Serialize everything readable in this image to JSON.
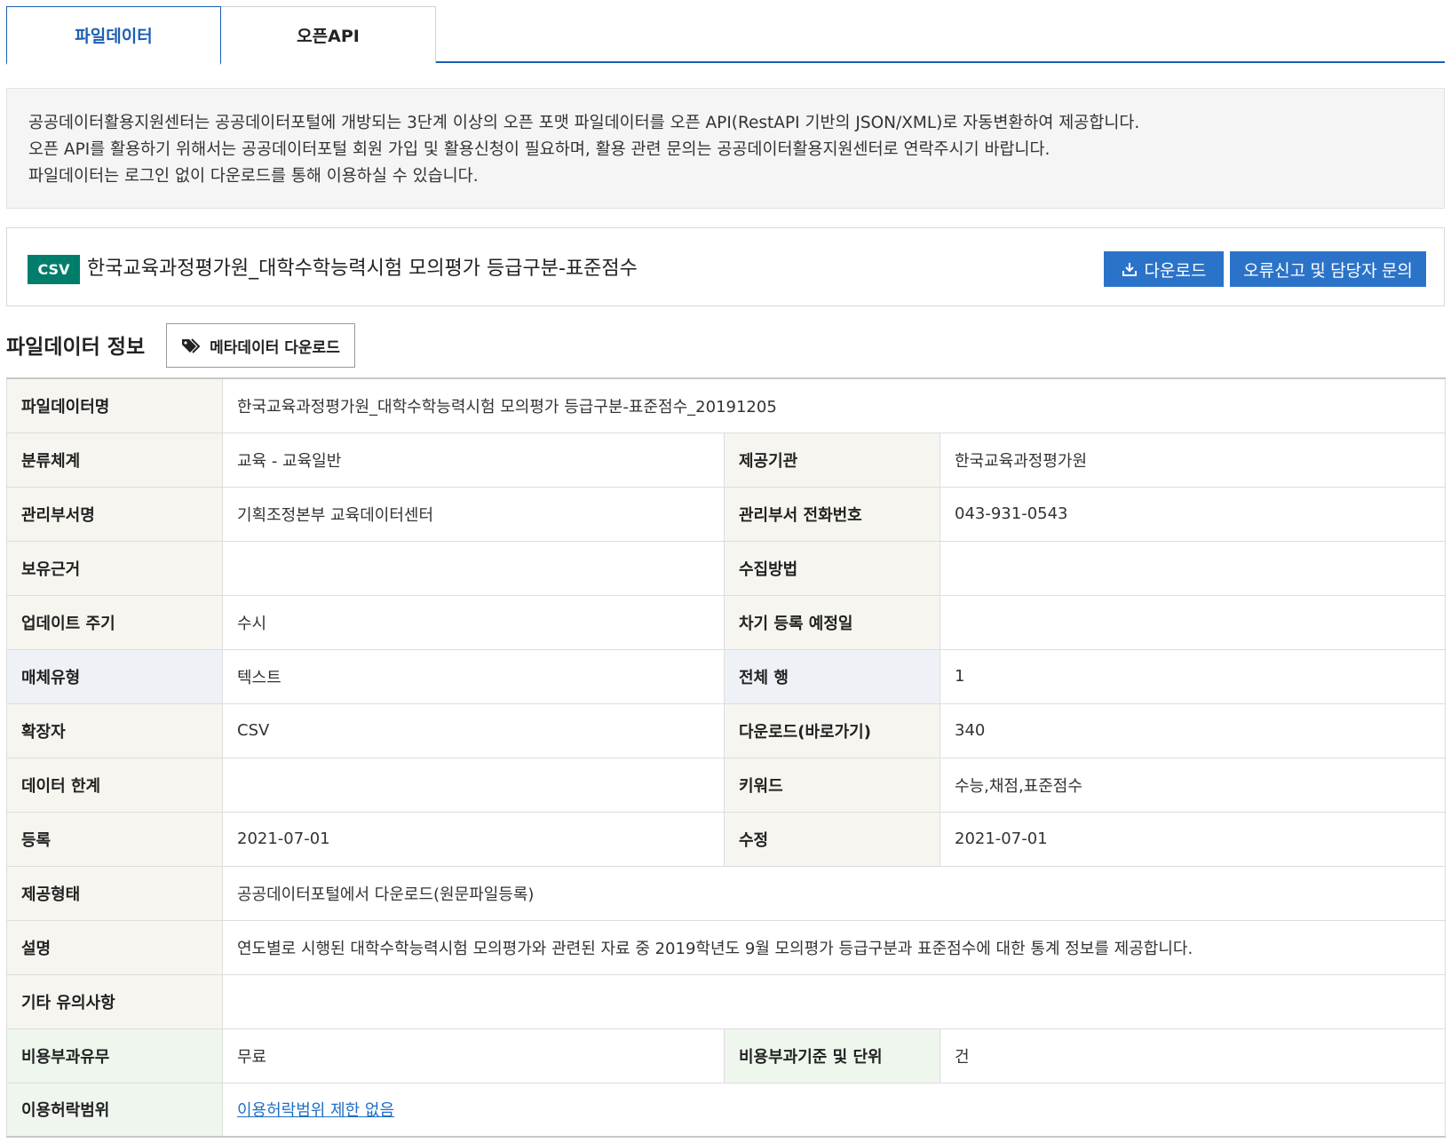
{
  "tabs": [
    {
      "label": "파일데이터",
      "active": true
    },
    {
      "label": "오픈API",
      "active": false
    }
  ],
  "notice": {
    "line1": "공공데이터활용지원센터는 공공데이터포털에 개방되는 3단계 이상의 오픈 포맷 파일데이터를 오픈 API(RestAPI 기반의 JSON/XML)로 자동변환하여 제공합니다.",
    "line2": "오픈 API를 활용하기 위해서는 공공데이터포털 회원 가입 및 활용신청이 필요하며, 활용 관련 문의는 공공데이터활용지원센터로 연락주시기 바랍니다.",
    "line3": "파일데이터는 로그인 없이 다운로드를 통해 이용하실 수 있습니다."
  },
  "dataset": {
    "format_badge": "CSV",
    "title": "한국교육과정평가원_대학수학능력시험 모의평가 등급구분-표준점수",
    "download_label": "다운로드",
    "report_label": "오류신고 및 담당자 문의"
  },
  "section": {
    "title": "파일데이터 정보",
    "meta_download_label": "메타데이터 다운로드"
  },
  "colors": {
    "accent": "#1b5fb4",
    "button_blue": "#2b73c9",
    "badge_green": "#007e6b",
    "link": "#1f6fc5"
  },
  "info": {
    "file_name": {
      "label": "파일데이터명",
      "value": "한국교육과정평가원_대학수학능력시험 모의평가 등급구분-표준점수_20191205"
    },
    "category": {
      "label": "분류체계",
      "value": "교육 - 교육일반"
    },
    "provider": {
      "label": "제공기관",
      "value": "한국교육과정평가원"
    },
    "dept": {
      "label": "관리부서명",
      "value": "기획조정본부 교육데이터센터"
    },
    "dept_phone": {
      "label": "관리부서 전화번호",
      "value": "043-931-0543"
    },
    "basis": {
      "label": "보유근거",
      "value": ""
    },
    "collect_method": {
      "label": "수집방법",
      "value": ""
    },
    "update_cycle": {
      "label": "업데이트 주기",
      "value": "수시"
    },
    "next_reg": {
      "label": "차기 등록 예정일",
      "value": ""
    },
    "media_type": {
      "label": "매체유형",
      "value": "텍스트"
    },
    "total_rows": {
      "label": "전체 행",
      "value": "1"
    },
    "extension": {
      "label": "확장자",
      "value": "CSV"
    },
    "downloads": {
      "label": "다운로드(바로가기)",
      "value": "340"
    },
    "data_limit": {
      "label": "데이터 한계",
      "value": ""
    },
    "keywords": {
      "label": "키워드",
      "value": "수능,채점,표준점수"
    },
    "registered": {
      "label": "등록",
      "value": "2021-07-01"
    },
    "modified": {
      "label": "수정",
      "value": "2021-07-01"
    },
    "provide_type": {
      "label": "제공형태",
      "value": "공공데이터포털에서 다운로드(원문파일등록)"
    },
    "description": {
      "label": "설명",
      "value": "연도별로 시행된 대학수학능력시험 모의평가와 관련된 자료 중 2019학년도 9월 모의평가 등급구분과 표준점수에 대한 통계 정보를 제공합니다."
    },
    "notes": {
      "label": "기타 유의사항",
      "value": ""
    },
    "fee": {
      "label": "비용부과유무",
      "value": "무료"
    },
    "fee_basis": {
      "label": "비용부과기준 및 단위",
      "value": "건"
    },
    "license": {
      "label": "이용허락범위",
      "value": "이용허락범위 제한 없음"
    }
  }
}
